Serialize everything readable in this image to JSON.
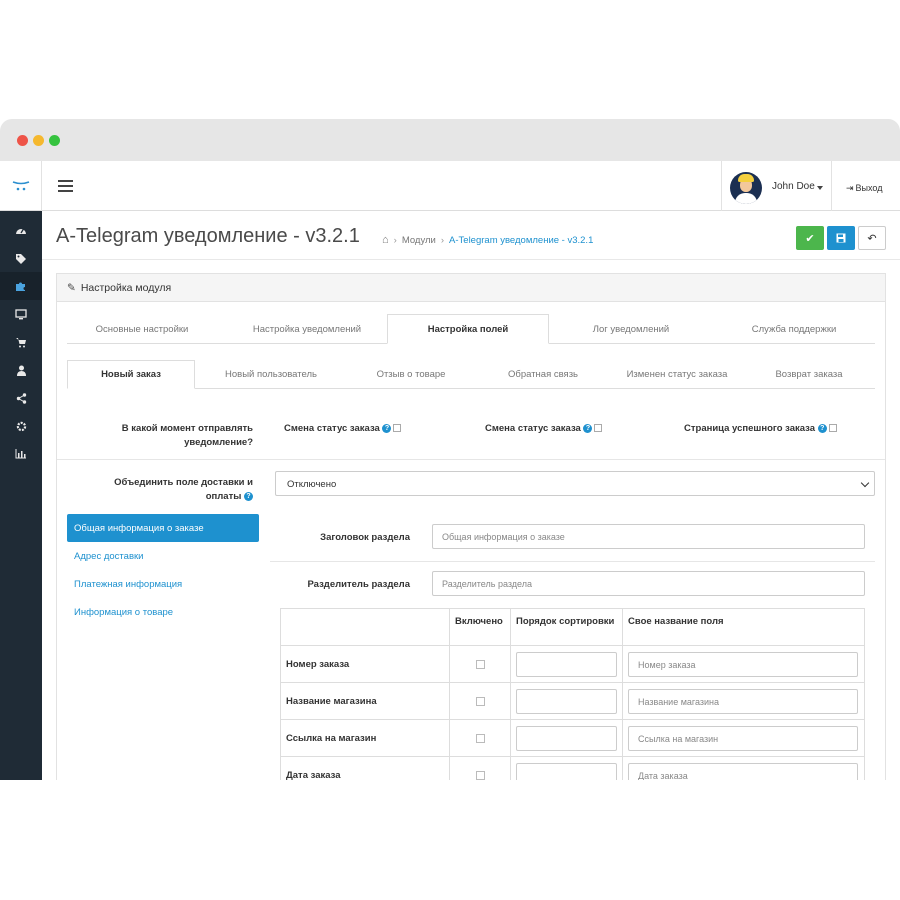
{
  "header": {
    "user_name": "John Doe",
    "logout_label": "Выход"
  },
  "sidebar": {
    "items": [
      {
        "icon": "dashboard-icon"
      },
      {
        "icon": "tags-icon"
      },
      {
        "icon": "puzzle-icon",
        "active": true
      },
      {
        "icon": "monitor-icon"
      },
      {
        "icon": "cart-icon"
      },
      {
        "icon": "user-icon"
      },
      {
        "icon": "share-icon"
      },
      {
        "icon": "gear-icon"
      },
      {
        "icon": "bar-chart-icon"
      }
    ]
  },
  "page": {
    "title": "A-Telegram уведомление - v3.2.1",
    "breadcrumb": [
      "Модули",
      "A-Telegram уведомление - v3.2.1"
    ]
  },
  "panel": {
    "heading": "Настройка модуля"
  },
  "main_tabs": [
    {
      "label": "Основные настройки"
    },
    {
      "label": "Настройка уведомлений"
    },
    {
      "label": "Настройка полей",
      "active": true
    },
    {
      "label": "Лог уведомлений"
    },
    {
      "label": "Служба поддержки"
    }
  ],
  "sub_tabs": [
    {
      "label": "Новый заказ",
      "active": true
    },
    {
      "label": "Новый пользователь"
    },
    {
      "label": "Отзыв о товаре"
    },
    {
      "label": "Обратная связь"
    },
    {
      "label": "Изменен статус заказа"
    },
    {
      "label": "Возврат заказа"
    }
  ],
  "notify_moment": {
    "label": "В какой момент отправлять уведомление?",
    "options": [
      "Смена статус заказа",
      "Смена статус заказа",
      "Страница успешного заказа"
    ]
  },
  "merge_fields": {
    "label": "Объединить поле доставки и оплаты",
    "value": "Отключено"
  },
  "sections": [
    {
      "label": "Общая информация о заказе",
      "active": true
    },
    {
      "label": "Адрес доставки"
    },
    {
      "label": "Платежная информация"
    },
    {
      "label": "Информация о товаре"
    }
  ],
  "section_title": {
    "label": "Заголовок раздела",
    "placeholder": "Общая информация о заказе"
  },
  "section_separator": {
    "label": "Разделитель раздела",
    "placeholder": "Разделитель раздела"
  },
  "fields_table": {
    "headers": [
      "",
      "Включено",
      "Порядок сортировки",
      "Свое название поля"
    ],
    "rows": [
      {
        "name": "Номер заказа",
        "placeholder": "Номер заказа"
      },
      {
        "name": "Название магазина",
        "placeholder": "Название магазина"
      },
      {
        "name": "Ссылка на магазин",
        "placeholder": "Ссылка на магазин"
      },
      {
        "name": "Дата заказа",
        "placeholder": "Дата заказа"
      }
    ]
  },
  "colors": {
    "sidebar_bg": "#1f2b36",
    "primary": "#1e91cf",
    "success": "#4cb64c"
  }
}
